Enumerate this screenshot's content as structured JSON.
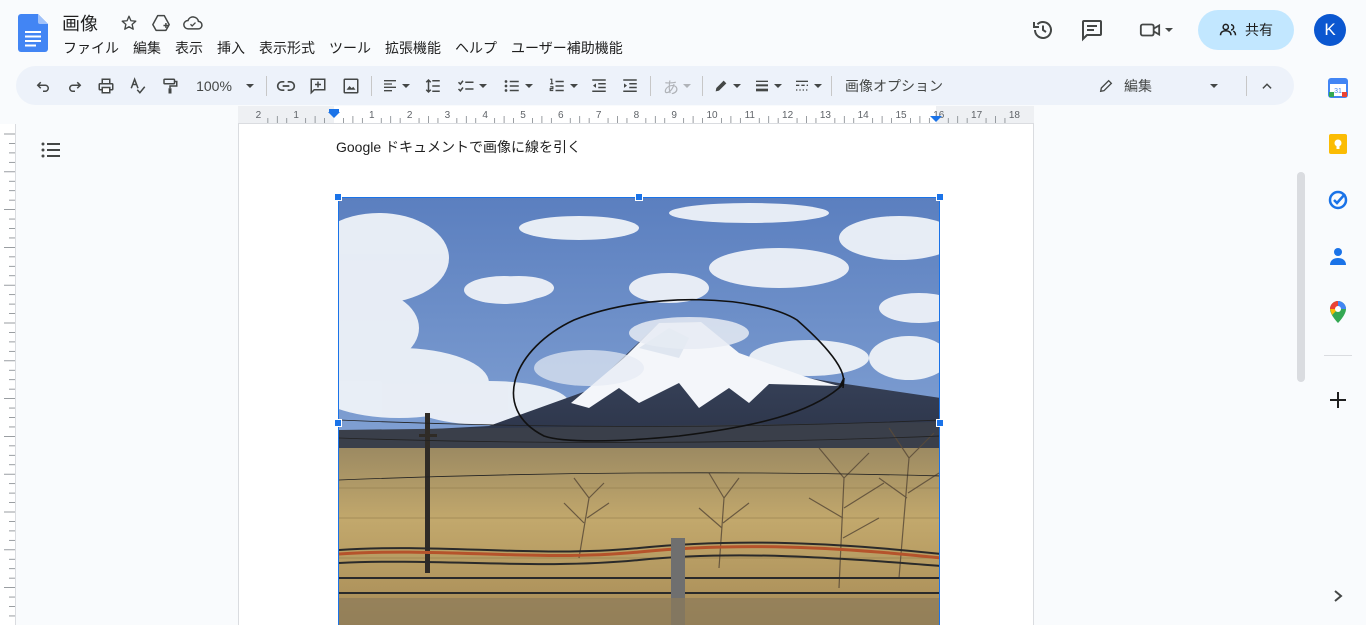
{
  "document": {
    "title": "画像",
    "body_text": "Google ドキュメントで画像に線を引く"
  },
  "menu": [
    "ファイル",
    "編集",
    "表示",
    "挿入",
    "表示形式",
    "ツール",
    "拡張機能",
    "ヘルプ",
    "ユーザー補助機能"
  ],
  "header": {
    "share_label": "共有",
    "avatar_initial": "K"
  },
  "toolbar": {
    "zoom": "100%",
    "input_char": "あ",
    "image_options_label": "画像オプション",
    "mode_label": "編集"
  },
  "ruler": {
    "labels": [
      "2",
      "1",
      "1",
      "2",
      "3",
      "4",
      "5",
      "6",
      "7",
      "8",
      "9",
      "10",
      "11",
      "12",
      "13",
      "14",
      "15",
      "16",
      "17",
      "18"
    ]
  },
  "colors": {
    "accent": "#1a73e8",
    "share_bg": "#c2e7ff",
    "avatar_bg": "#0b57d0",
    "toolbar_bg": "#edf2fa",
    "drawn_line": "#111111"
  }
}
